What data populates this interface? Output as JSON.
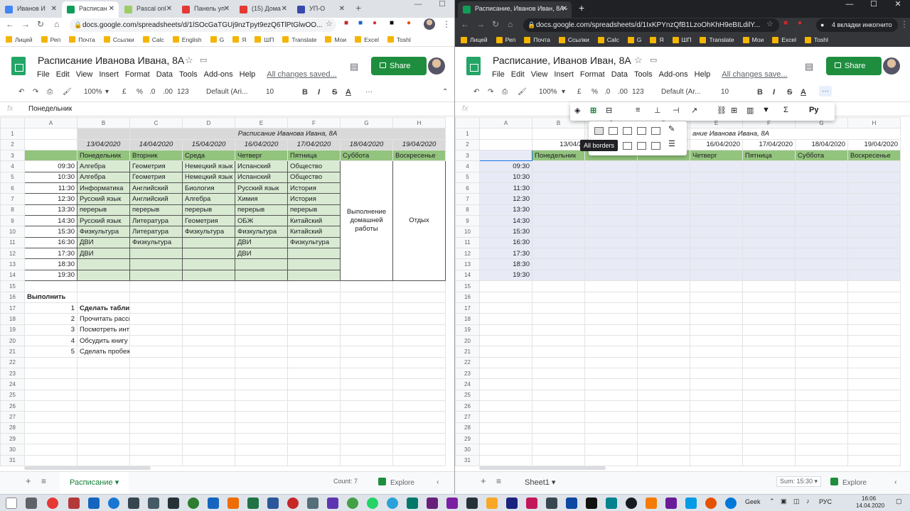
{
  "left": {
    "tabs": [
      {
        "title": "Иванов И"
      },
      {
        "title": "Расписан"
      },
      {
        "title": "Pascal onl"
      },
      {
        "title": "Панель уп"
      },
      {
        "title": "(15) Домa"
      },
      {
        "title": "УП-О"
      }
    ],
    "url": "docs.google.com/spreadsheets/d/1lSOcGaTGUj9nzTpyt9ezQ6TlPtGlwOO...",
    "bookmarks": [
      "Лицей",
      "Реп",
      "Почта",
      "Ссылки",
      "Calc",
      "English",
      "G",
      "Я",
      "ШП",
      "Translate",
      "Мои",
      "Excel",
      "Toshl"
    ],
    "doc_title": "Расписание Иванова Ивана, 8А",
    "menus": [
      "File",
      "Edit",
      "View",
      "Insert",
      "Format",
      "Data",
      "Tools",
      "Add-ons",
      "Help"
    ],
    "saved_status": "All changes saved...",
    "share_label": "Share",
    "toolbar": {
      "zoom": "100%",
      "currency": "£",
      "percent": "%",
      "dec1": ".0",
      "dec2": ".00",
      "more_formats": "123",
      "font": "Default (Ari...",
      "size": "10",
      "bold": "B",
      "italic": "I",
      "strike": "S",
      "color": "A"
    },
    "formula_value": "Понедельник",
    "columns": [
      "A",
      "B",
      "C",
      "D",
      "E",
      "F",
      "G",
      "H"
    ],
    "rows": [
      [
        "",
        "",
        "",
        "",
        "Расписание Иванова Ивана, 8А",
        "",
        "",
        ""
      ],
      [
        "",
        "13/04/2020",
        "14/04/2020",
        "15/04/2020",
        "16/04/2020",
        "17/04/2020",
        "18/04/2020",
        "19/04/2020"
      ],
      [
        "",
        "Понедельник",
        "Вторник",
        "Среда",
        "Четверг",
        "Пятница",
        "Суббота",
        "Воскресенье"
      ],
      [
        "09:30",
        "Алгебра",
        "Геометрия",
        "Немецкий язык",
        "Испанский",
        "Общество",
        "",
        ""
      ],
      [
        "10:30",
        "Алгебра",
        "Геометрия",
        "Немецкий язык",
        "Испанский",
        "Общество",
        "",
        ""
      ],
      [
        "11:30",
        "Информатика",
        "Английский",
        "Биология",
        "Русский язык",
        "История",
        "",
        ""
      ],
      [
        "12:30",
        "Русский язык",
        "Английский",
        "Алгебра",
        "Химия",
        "История",
        "",
        ""
      ],
      [
        "13:30",
        "перерыв",
        "перерыв",
        "перерыв",
        "перерыв",
        "перерыв",
        "",
        ""
      ],
      [
        "14:30",
        "Русский язык",
        "Литература",
        "Геометрия",
        "ОБЖ",
        "Китайский",
        "",
        ""
      ],
      [
        "15:30",
        "Физкультура",
        "Литература",
        "Физкультура",
        "Физкультура",
        "Китайский",
        "",
        ""
      ],
      [
        "16:30",
        "ДВИ",
        "Физкультура",
        "",
        "ДВИ",
        "Физкультура",
        "",
        ""
      ],
      [
        "17:30",
        "ДВИ",
        "",
        "",
        "ДВИ",
        "",
        "",
        ""
      ],
      [
        "18:30",
        "",
        "",
        "",
        "",
        "",
        "",
        ""
      ],
      [
        "19:30",
        "",
        "",
        "",
        "",
        "",
        "",
        ""
      ],
      [
        "",
        "",
        "",
        "",
        "",
        "",
        "",
        ""
      ],
      [
        "Выполнить",
        "",
        "",
        "",
        "",
        "",
        "",
        ""
      ],
      [
        "1",
        "Сделать таблицу по информатике",
        "",
        "",
        "",
        "",
        "",
        ""
      ],
      [
        "2",
        "Прочитать рассказ Чехова",
        "",
        "",
        "",
        "",
        "",
        ""
      ],
      [
        "3",
        "Посмотреть интересное кино",
        "",
        "",
        "",
        "",
        "",
        ""
      ],
      [
        "4",
        "Обсудить книгу с одноклассниками",
        "",
        "",
        "",
        "",
        "",
        ""
      ],
      [
        "5",
        "Сделать пробежку",
        "",
        "",
        "",
        "",
        "",
        ""
      ]
    ],
    "merged_g": "Выполнение домашней работы",
    "merged_h": "Отдых",
    "sheet_tab": "Расписание",
    "status": "Count: 7",
    "explore": "Explore"
  },
  "right": {
    "tabs": [
      {
        "title": "Расписание, Иванов Иван, 8А -"
      }
    ],
    "url": "docs.google.com/spreadsheets/d/1IxKPYnzQfB1LzoOhKhH9eBILdilY...",
    "incognito": "4 вкладки инкогнито",
    "bookmarks": [
      "Лицей",
      "Реп",
      "Почта",
      "Ссылки",
      "Calc",
      "G",
      "Я",
      "ШП",
      "Translate",
      "Мои",
      "Excel",
      "Toshl"
    ],
    "doc_title": "Расписание, Иванов Иван, 8А",
    "menus": [
      "File",
      "Edit",
      "View",
      "Insert",
      "Format",
      "Data",
      "Tools",
      "Add-ons",
      "Help"
    ],
    "saved_status": "All changes save...",
    "share_label": "Share",
    "toolbar": {
      "zoom": "100%",
      "currency": "£",
      "percent": "%",
      "dec1": ".0",
      "dec2": ".00",
      "more_formats": "123",
      "font": "Default (Ar...",
      "size": "10",
      "bold": "B",
      "italic": "I",
      "strike": "S",
      "color": "A"
    },
    "tooltip": "All borders",
    "columns": [
      "A",
      "B",
      "C",
      "D",
      "E",
      "F",
      "G",
      "H"
    ],
    "rows": [
      [
        "",
        "",
        "",
        "",
        "ание Иванова Ивана, 8А",
        "",
        "",
        ""
      ],
      [
        "",
        "13/04/2",
        "",
        "",
        "16/04/2020",
        "17/04/2020",
        "18/04/2020",
        "19/04/2020"
      ],
      [
        "",
        "Понедельник",
        "",
        "",
        "Четверг",
        "Пятница",
        "Суббота",
        "Воскресенье"
      ],
      [
        "09:30",
        "",
        "",
        "",
        "",
        "",
        "",
        ""
      ],
      [
        "10:30",
        "",
        "",
        "",
        "",
        "",
        "",
        ""
      ],
      [
        "11:30",
        "",
        "",
        "",
        "",
        "",
        "",
        ""
      ],
      [
        "12:30",
        "",
        "",
        "",
        "",
        "",
        "",
        ""
      ],
      [
        "13:30",
        "",
        "",
        "",
        "",
        "",
        "",
        ""
      ],
      [
        "14:30",
        "",
        "",
        "",
        "",
        "",
        "",
        ""
      ],
      [
        "15:30",
        "",
        "",
        "",
        "",
        "",
        "",
        ""
      ],
      [
        "16:30",
        "",
        "",
        "",
        "",
        "",
        "",
        ""
      ],
      [
        "17:30",
        "",
        "",
        "",
        "",
        "",
        "",
        ""
      ],
      [
        "18:30",
        "",
        "",
        "",
        "",
        "",
        "",
        ""
      ],
      [
        "19:30",
        "",
        "",
        "",
        "",
        "",
        "",
        ""
      ]
    ],
    "sheet_tab": "Sheet1",
    "status": "Sum: 15:30",
    "explore": "Explore"
  },
  "row_numbers": [
    "1",
    "2",
    "3",
    "4",
    "5",
    "6",
    "7",
    "8",
    "9",
    "10",
    "11",
    "12",
    "13",
    "14",
    "15",
    "16",
    "17",
    "18",
    "19",
    "20",
    "21",
    "22",
    "23",
    "24",
    "25",
    "26",
    "27",
    "28",
    "29",
    "30",
    "31"
  ],
  "taskbar": {
    "lang": "РУС",
    "time": "16:06",
    "date": "14.04.2020",
    "geek": "Geek"
  },
  "colors": {
    "header_grey": "#d9d9d9",
    "day_row_green": "#93c47d",
    "body_green": "#d9ead3",
    "share_green": "#1e8e3e",
    "selection": "#e8eaf6"
  }
}
